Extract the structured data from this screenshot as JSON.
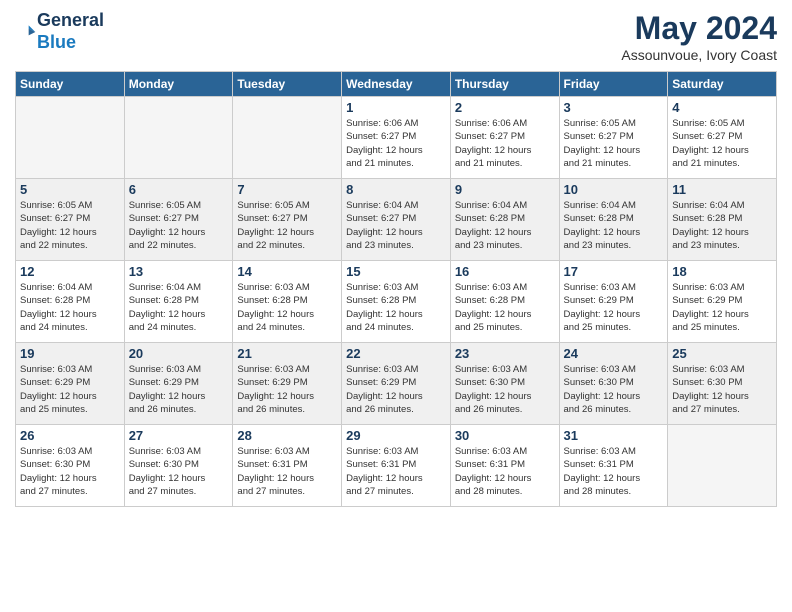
{
  "header": {
    "logo_line1": "General",
    "logo_line2": "Blue",
    "month": "May 2024",
    "location": "Assounvoue, Ivory Coast"
  },
  "weekdays": [
    "Sunday",
    "Monday",
    "Tuesday",
    "Wednesday",
    "Thursday",
    "Friday",
    "Saturday"
  ],
  "weeks": [
    [
      {
        "day": "",
        "info": ""
      },
      {
        "day": "",
        "info": ""
      },
      {
        "day": "",
        "info": ""
      },
      {
        "day": "1",
        "info": "Sunrise: 6:06 AM\nSunset: 6:27 PM\nDaylight: 12 hours\nand 21 minutes."
      },
      {
        "day": "2",
        "info": "Sunrise: 6:06 AM\nSunset: 6:27 PM\nDaylight: 12 hours\nand 21 minutes."
      },
      {
        "day": "3",
        "info": "Sunrise: 6:05 AM\nSunset: 6:27 PM\nDaylight: 12 hours\nand 21 minutes."
      },
      {
        "day": "4",
        "info": "Sunrise: 6:05 AM\nSunset: 6:27 PM\nDaylight: 12 hours\nand 21 minutes."
      }
    ],
    [
      {
        "day": "5",
        "info": "Sunrise: 6:05 AM\nSunset: 6:27 PM\nDaylight: 12 hours\nand 22 minutes."
      },
      {
        "day": "6",
        "info": "Sunrise: 6:05 AM\nSunset: 6:27 PM\nDaylight: 12 hours\nand 22 minutes."
      },
      {
        "day": "7",
        "info": "Sunrise: 6:05 AM\nSunset: 6:27 PM\nDaylight: 12 hours\nand 22 minutes."
      },
      {
        "day": "8",
        "info": "Sunrise: 6:04 AM\nSunset: 6:27 PM\nDaylight: 12 hours\nand 23 minutes."
      },
      {
        "day": "9",
        "info": "Sunrise: 6:04 AM\nSunset: 6:28 PM\nDaylight: 12 hours\nand 23 minutes."
      },
      {
        "day": "10",
        "info": "Sunrise: 6:04 AM\nSunset: 6:28 PM\nDaylight: 12 hours\nand 23 minutes."
      },
      {
        "day": "11",
        "info": "Sunrise: 6:04 AM\nSunset: 6:28 PM\nDaylight: 12 hours\nand 23 minutes."
      }
    ],
    [
      {
        "day": "12",
        "info": "Sunrise: 6:04 AM\nSunset: 6:28 PM\nDaylight: 12 hours\nand 24 minutes."
      },
      {
        "day": "13",
        "info": "Sunrise: 6:04 AM\nSunset: 6:28 PM\nDaylight: 12 hours\nand 24 minutes."
      },
      {
        "day": "14",
        "info": "Sunrise: 6:03 AM\nSunset: 6:28 PM\nDaylight: 12 hours\nand 24 minutes."
      },
      {
        "day": "15",
        "info": "Sunrise: 6:03 AM\nSunset: 6:28 PM\nDaylight: 12 hours\nand 24 minutes."
      },
      {
        "day": "16",
        "info": "Sunrise: 6:03 AM\nSunset: 6:28 PM\nDaylight: 12 hours\nand 25 minutes."
      },
      {
        "day": "17",
        "info": "Sunrise: 6:03 AM\nSunset: 6:29 PM\nDaylight: 12 hours\nand 25 minutes."
      },
      {
        "day": "18",
        "info": "Sunrise: 6:03 AM\nSunset: 6:29 PM\nDaylight: 12 hours\nand 25 minutes."
      }
    ],
    [
      {
        "day": "19",
        "info": "Sunrise: 6:03 AM\nSunset: 6:29 PM\nDaylight: 12 hours\nand 25 minutes."
      },
      {
        "day": "20",
        "info": "Sunrise: 6:03 AM\nSunset: 6:29 PM\nDaylight: 12 hours\nand 26 minutes."
      },
      {
        "day": "21",
        "info": "Sunrise: 6:03 AM\nSunset: 6:29 PM\nDaylight: 12 hours\nand 26 minutes."
      },
      {
        "day": "22",
        "info": "Sunrise: 6:03 AM\nSunset: 6:29 PM\nDaylight: 12 hours\nand 26 minutes."
      },
      {
        "day": "23",
        "info": "Sunrise: 6:03 AM\nSunset: 6:30 PM\nDaylight: 12 hours\nand 26 minutes."
      },
      {
        "day": "24",
        "info": "Sunrise: 6:03 AM\nSunset: 6:30 PM\nDaylight: 12 hours\nand 26 minutes."
      },
      {
        "day": "25",
        "info": "Sunrise: 6:03 AM\nSunset: 6:30 PM\nDaylight: 12 hours\nand 27 minutes."
      }
    ],
    [
      {
        "day": "26",
        "info": "Sunrise: 6:03 AM\nSunset: 6:30 PM\nDaylight: 12 hours\nand 27 minutes."
      },
      {
        "day": "27",
        "info": "Sunrise: 6:03 AM\nSunset: 6:30 PM\nDaylight: 12 hours\nand 27 minutes."
      },
      {
        "day": "28",
        "info": "Sunrise: 6:03 AM\nSunset: 6:31 PM\nDaylight: 12 hours\nand 27 minutes."
      },
      {
        "day": "29",
        "info": "Sunrise: 6:03 AM\nSunset: 6:31 PM\nDaylight: 12 hours\nand 27 minutes."
      },
      {
        "day": "30",
        "info": "Sunrise: 6:03 AM\nSunset: 6:31 PM\nDaylight: 12 hours\nand 28 minutes."
      },
      {
        "day": "31",
        "info": "Sunrise: 6:03 AM\nSunset: 6:31 PM\nDaylight: 12 hours\nand 28 minutes."
      },
      {
        "day": "",
        "info": ""
      }
    ]
  ]
}
